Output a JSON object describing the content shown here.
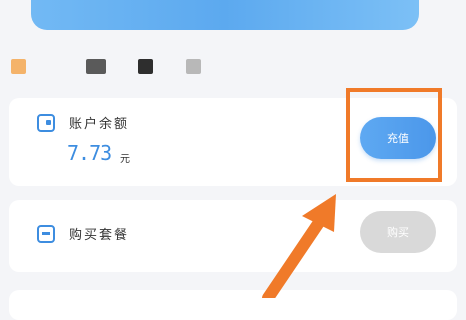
{
  "balance_section": {
    "label": "账户余额",
    "amount": "7.73",
    "unit": "元",
    "recharge_button": "充值"
  },
  "package_section": {
    "label": "购买套餐",
    "buy_button": "购买"
  },
  "colors": {
    "accent": "#3d8de0",
    "highlight": "#f07a29",
    "disabled_button": "#d9d9d9",
    "indicator_orange": "#f4b36a",
    "indicator_gray": "#8a8a8a",
    "indicator_dark": "#2e2e2e",
    "indicator_light": "#b8b8b8"
  },
  "icons": {
    "balance": "wallet-icon",
    "package": "package-icon",
    "annotation": "arrow-icon"
  }
}
